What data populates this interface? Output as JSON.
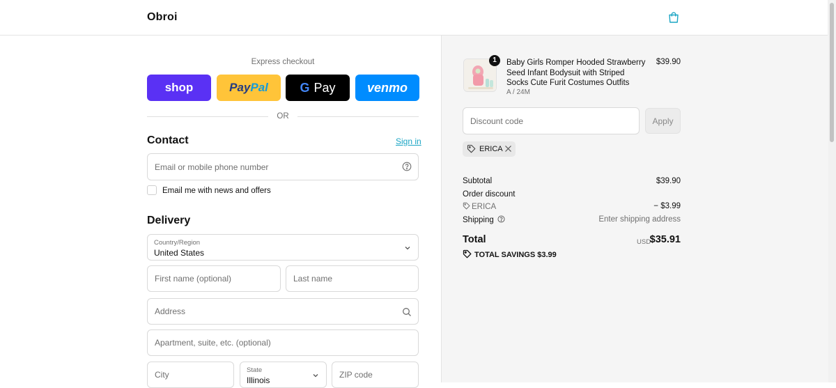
{
  "header": {
    "brand": "Obroi",
    "cart_icon": "shopping-bag-icon",
    "accent_color": "#1aa5c4"
  },
  "express": {
    "label": "Express checkout",
    "buttons": {
      "shop": "shop",
      "paypal_a": "Pay",
      "paypal_b": "Pal",
      "gpay_g": "G",
      "gpay_text": "Pay",
      "venmo": "venmo"
    },
    "or_text": "OR"
  },
  "contact": {
    "title": "Contact",
    "sign_in": "Sign in",
    "email_placeholder": "Email or mobile phone number",
    "newsletter_label": "Email me with news and offers"
  },
  "delivery": {
    "title": "Delivery",
    "country_label": "Country/Region",
    "country_value": "United States",
    "first_name_placeholder": "First name (optional)",
    "last_name_placeholder": "Last name",
    "address_placeholder": "Address",
    "apartment_placeholder": "Apartment, suite, etc. (optional)",
    "city_placeholder": "City",
    "state_label": "State",
    "state_value": "Illinois",
    "zip_placeholder": "ZIP code"
  },
  "order": {
    "product": {
      "name": "Baby Girls Romper Hooded Strawberry Seed Infant Bodysuit with Striped Socks Cute Furit Costumes Outfits",
      "variant": "A / 24M",
      "price": "$39.90",
      "quantity": "1"
    },
    "discount_placeholder": "Discount code",
    "apply_label": "Apply",
    "applied_code": "ERICA",
    "summary": {
      "subtotal_label": "Subtotal",
      "subtotal_value": "$39.90",
      "order_discount_label": "Order discount",
      "discount_code": "ERICA",
      "discount_value": "− $3.99",
      "shipping_label": "Shipping",
      "shipping_value": "Enter shipping address",
      "total_label": "Total",
      "currency": "USD",
      "total_value": "$35.91",
      "savings_text": "TOTAL SAVINGS $3.99"
    }
  }
}
